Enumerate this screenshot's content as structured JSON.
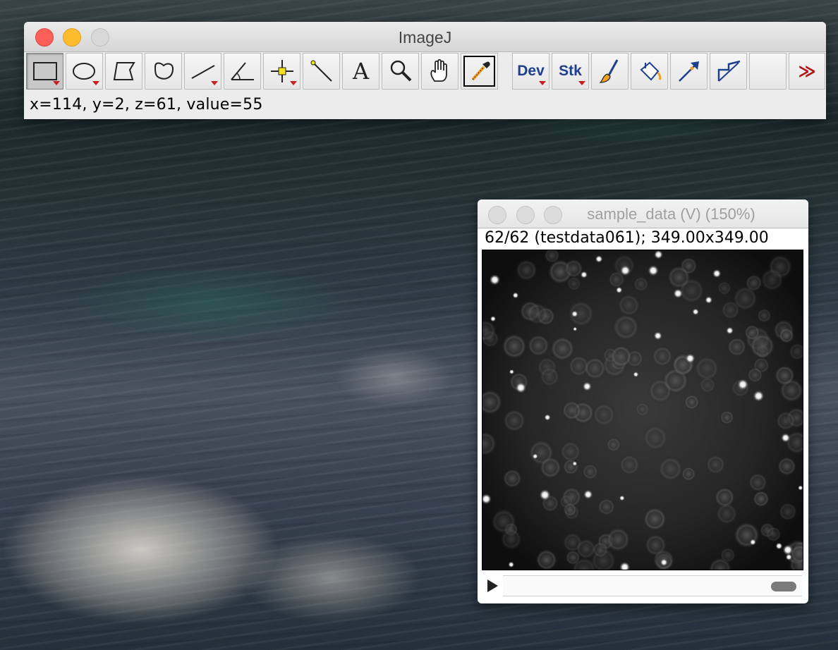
{
  "ij_window": {
    "title": "ImageJ",
    "status": "x=114, y=2, z=61, value=55",
    "tools": [
      {
        "name": "rectangle-tool",
        "icon": "rectangle-icon",
        "selected": true,
        "menu": true
      },
      {
        "name": "oval-tool",
        "icon": "oval-icon",
        "menu": true
      },
      {
        "name": "polygon-tool",
        "icon": "polygon-icon"
      },
      {
        "name": "freehand-tool",
        "icon": "freehand-icon"
      },
      {
        "name": "line-tool",
        "icon": "line-icon",
        "menu": true
      },
      {
        "name": "angle-tool",
        "icon": "angle-icon"
      },
      {
        "name": "point-tool",
        "icon": "point-icon",
        "menu": true
      },
      {
        "name": "wand-tool",
        "icon": "wand-icon"
      },
      {
        "name": "text-tool",
        "icon": "text-icon"
      },
      {
        "name": "magnifier-tool",
        "icon": "magnifier-icon"
      },
      {
        "name": "hand-tool",
        "icon": "hand-icon"
      },
      {
        "name": "color-picker-tool",
        "icon": "eyedropper-icon",
        "active": true
      },
      {
        "name": "dev-menu-tool",
        "label": "Dev",
        "menu": true
      },
      {
        "name": "stack-menu-tool",
        "label": "Stk",
        "menu": true
      },
      {
        "name": "brush-tool",
        "icon": "brush-icon"
      },
      {
        "name": "flood-fill-tool",
        "icon": "bucket-icon"
      },
      {
        "name": "arrow-tool",
        "icon": "arrow-icon"
      },
      {
        "name": "overlay-tool",
        "icon": "overlay-icon"
      },
      {
        "name": "empty-slot",
        "icon": ""
      },
      {
        "name": "more-tools-button",
        "label": "≫"
      }
    ],
    "dev_label": "Dev",
    "stk_label": "Stk",
    "text_tool_glyph": "A",
    "more_label": "≫"
  },
  "image_window": {
    "title": "sample_data (V) (150%)",
    "subtitle": "62/62 (testdata061); 349.00x349.00",
    "colors": {
      "background": "#151515"
    }
  }
}
